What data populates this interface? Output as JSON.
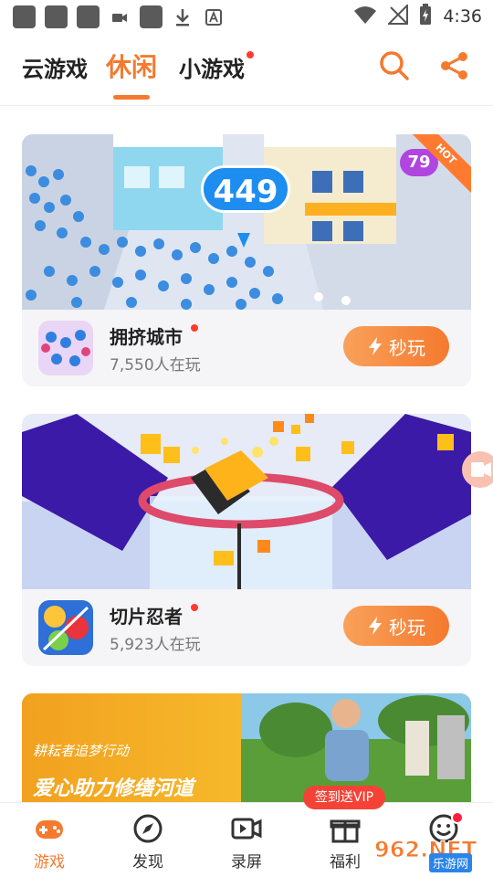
{
  "status_bar": {
    "time": "4:36"
  },
  "top_tabs": {
    "items": [
      {
        "label": "云游戏"
      },
      {
        "label": "休闲",
        "active": true
      },
      {
        "label": "小游戏",
        "badge_dot": true
      }
    ]
  },
  "games": [
    {
      "name": "拥挤城市",
      "players": "7,550人在玩",
      "play_label": "秒玩",
      "banner_count": "449",
      "score_badge": "79",
      "hot_tag": "HOT"
    },
    {
      "name": "切片忍者",
      "players": "5,923人在玩",
      "play_label": "秒玩"
    }
  ],
  "promo_banner": {
    "small_text": "耕耘者追梦行动",
    "big_text": "爱心助力修缮河道"
  },
  "bottom_nav": {
    "items": [
      {
        "label": "游戏",
        "icon": "gamepad-icon",
        "active": true
      },
      {
        "label": "发现",
        "icon": "compass-icon"
      },
      {
        "label": "录屏",
        "icon": "video-icon"
      },
      {
        "label": "福利",
        "icon": "gift-icon"
      },
      {
        "label": "",
        "icon": "smile-icon"
      }
    ],
    "sign_badge": "签到送VIP"
  },
  "watermark": {
    "brand": "962.NET",
    "sub": "乐游网"
  },
  "colors": {
    "accent": "#f47a2f",
    "badge_red": "#ff3b30"
  }
}
